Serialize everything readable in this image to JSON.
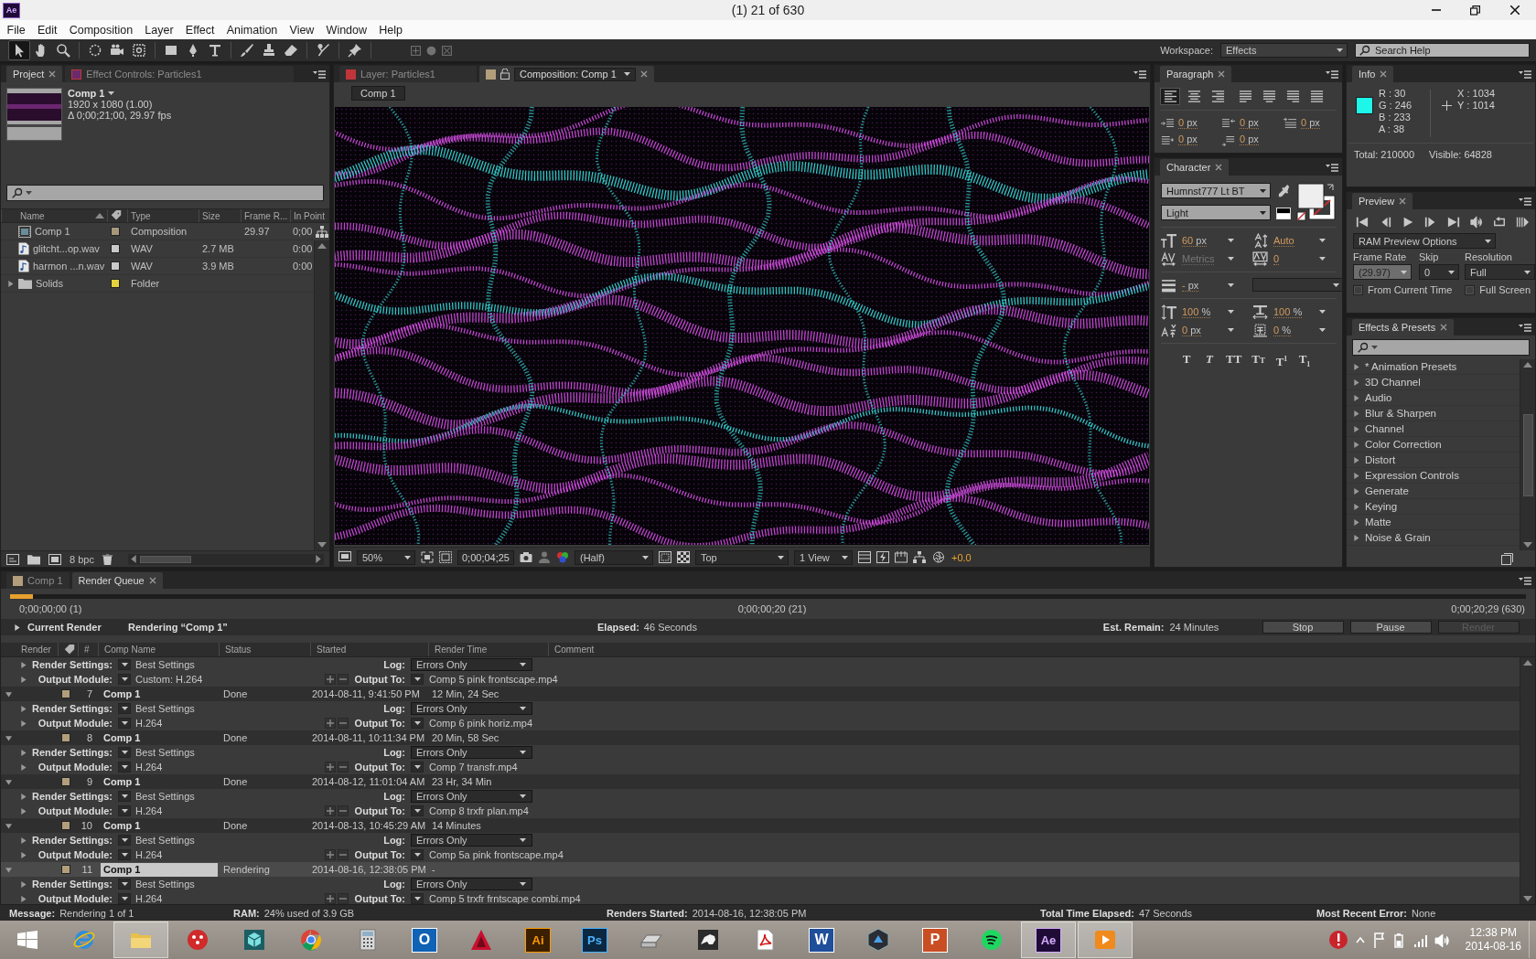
{
  "window": {
    "app_icon": "Ae",
    "title": "(1) 21 of 630"
  },
  "menu": [
    "File",
    "Edit",
    "Composition",
    "Layer",
    "Effect",
    "Animation",
    "View",
    "Window",
    "Help"
  ],
  "toolbar": {
    "tools": [
      {
        "kind": "selection",
        "selected": true
      },
      {
        "kind": "hand",
        "selected": false
      },
      {
        "kind": "zoom",
        "selected": false
      },
      {
        "kind": "rotate",
        "selected": false
      },
      {
        "kind": "camera",
        "selected": false
      },
      {
        "kind": "pan_behind",
        "selected": false
      },
      {
        "kind": "rectangle",
        "selected": false
      },
      {
        "kind": "pen",
        "selected": false
      },
      {
        "kind": "type",
        "selected": false
      },
      {
        "kind": "brush",
        "selected": false
      },
      {
        "kind": "stamp",
        "selected": false
      },
      {
        "kind": "eraser",
        "selected": false
      },
      {
        "kind": "roto",
        "selected": false
      },
      {
        "kind": "pin",
        "selected": false
      }
    ],
    "axis_modes": [
      {
        "kind": "local",
        "disabled": true
      },
      {
        "kind": "world",
        "disabled": true
      },
      {
        "kind": "view",
        "disabled": true
      }
    ],
    "workspace_label": "Workspace:",
    "workspace": "Effects",
    "search_placeholder": "Search Help"
  },
  "project": {
    "tabs": [
      {
        "label": "Project",
        "selected": true
      },
      {
        "kind": "effect_controls",
        "label": "Effect Controls: Particles1",
        "selected": false
      }
    ],
    "comp": {
      "name": "Comp 1",
      "size": "1920 x 1080 (1.00)",
      "duration": "Δ 0;00;21;00, 29.97 fps"
    },
    "columns": [
      "Name",
      "Type",
      "Size",
      "Frame R...",
      "In Point"
    ],
    "rows": [
      {
        "kind": "composition",
        "name": "Comp 1",
        "color": "#a8977b",
        "type": "Composition",
        "frame_rate": "29.97",
        "in_point": "0;00"
      },
      {
        "kind": "audio",
        "name": "glitcht...op.wav",
        "color": "#c9c9c9",
        "type": "WAV",
        "size": "2.7 MB",
        "in_point": "0:00"
      },
      {
        "kind": "audio",
        "name": "harmon ...n.wav",
        "color": "#c9c9c9",
        "type": "WAV",
        "size": "3.9 MB",
        "in_point": "0:00"
      },
      {
        "kind": "folder",
        "name": "Solids",
        "color": "#e3d23e",
        "type": "Folder",
        "expanded": false
      }
    ],
    "bit_depth": "8 bpc"
  },
  "composition": {
    "tabs": [
      {
        "kind": "layer",
        "label": "Layer: Particles1",
        "selected": false
      },
      {
        "kind": "composition",
        "label": "Composition: Comp 1",
        "selected": true,
        "locked": false
      }
    ],
    "breadcrumb": "Comp 1",
    "footer": {
      "zoom": "50%",
      "timecode": "0;00;04;25",
      "resolution": "(Half)",
      "view": "Top",
      "layout": "1 View",
      "exposure": "+0.0"
    }
  },
  "paragraph": {
    "tabs": [
      {
        "label": "Paragraph",
        "selected": true
      }
    ],
    "align": [
      {
        "kind": "left",
        "selected": true
      },
      {
        "kind": "center",
        "selected": false
      },
      {
        "kind": "right",
        "selected": false
      },
      {
        "kind": "justify_left",
        "selected": false
      },
      {
        "kind": "justify_center",
        "selected": false
      },
      {
        "kind": "justify_right",
        "selected": false
      },
      {
        "kind": "justify_all",
        "selected": false
      }
    ],
    "spacing": [
      {
        "kind": "indent_left",
        "value": "0",
        "unit": "px"
      },
      {
        "kind": "indent_right",
        "value": "0",
        "unit": "px"
      },
      {
        "kind": "indent_first",
        "value": "0",
        "unit": "px"
      },
      {
        "kind": "space_before",
        "value": "0",
        "unit": "px"
      },
      {
        "kind": "space_after",
        "value": "0",
        "unit": "px"
      }
    ]
  },
  "character": {
    "tabs": [
      {
        "label": "Character",
        "selected": true
      }
    ],
    "font": "Humnst777 Lt BT",
    "style": "Light",
    "groups": [
      [
        {
          "kind": "size",
          "value": "60",
          "unit": "px",
          "disabled": false
        },
        {
          "kind": "leading",
          "value": "Auto",
          "disabled": false
        },
        {
          "kind": "kerning",
          "value": "Metrics",
          "disabled": true
        },
        {
          "kind": "tracking",
          "value": "0",
          "disabled": false
        }
      ],
      [
        {
          "kind": "stroke",
          "value": "-",
          "unit": "px",
          "disabled": false
        }
      ],
      [
        {
          "kind": "vscale",
          "value": "100",
          "unit": "%",
          "disabled": false
        },
        {
          "kind": "hscale",
          "value": "100",
          "unit": "%",
          "disabled": false
        },
        {
          "kind": "baseline",
          "value": "0",
          "unit": "px",
          "disabled": false
        },
        {
          "kind": "tsume",
          "value": "0",
          "unit": "%",
          "disabled": false
        }
      ]
    ],
    "styles": [
      {
        "kind": "bold",
        "label": "T"
      },
      {
        "kind": "italic",
        "label": "T"
      },
      {
        "kind": "all_caps",
        "label": "TT"
      },
      {
        "kind": "small_caps",
        "label": "TT"
      },
      {
        "kind": "superscript",
        "label": "T$^{1}$"
      },
      {
        "kind": "subscript",
        "label": "T$_{1}$"
      }
    ]
  },
  "info": {
    "tabs": [
      {
        "label": "Info",
        "selected": true
      }
    ],
    "color": "#1ef6e9",
    "rgba": [
      "R : 30",
      "G : 246",
      "B : 233",
      "A : 38"
    ],
    "position": [
      "X : 1034",
      "Y : 1014"
    ],
    "total": "Total: 210000",
    "visible": "Visible: 64828"
  },
  "preview": {
    "tabs": [
      {
        "label": "Preview",
        "selected": true
      }
    ],
    "controls": [
      {
        "kind": "first"
      },
      {
        "kind": "previous"
      },
      {
        "kind": "play"
      },
      {
        "kind": "next"
      },
      {
        "kind": "last"
      },
      {
        "kind": "audio"
      },
      {
        "kind": "loop"
      },
      {
        "kind": "ram"
      }
    ],
    "options": "RAM Preview Options",
    "fields": [
      {
        "label": "Frame Rate",
        "value": "(29.97)"
      },
      {
        "label": "Skip",
        "value": "0"
      },
      {
        "label": "Resolution",
        "value": "Full"
      }
    ],
    "checkboxes": [
      {
        "label": "From Current Time",
        "checked": false
      },
      {
        "label": "Full Screen",
        "checked": false
      }
    ]
  },
  "effects": {
    "tabs": [
      {
        "label": "Effects & Presets",
        "selected": true
      }
    ],
    "items": [
      {
        "label": "* Animation Presets",
        "expanded": false
      },
      {
        "label": "3D Channel",
        "expanded": false
      },
      {
        "label": "Audio",
        "expanded": false
      },
      {
        "label": "Blur & Sharpen",
        "expanded": false
      },
      {
        "label": "Channel",
        "expanded": false
      },
      {
        "label": "Color Correction",
        "expanded": false
      },
      {
        "label": "Distort",
        "expanded": false
      },
      {
        "label": "Expression Controls",
        "expanded": false
      },
      {
        "label": "Generate",
        "expanded": false
      },
      {
        "label": "Keying",
        "expanded": false
      },
      {
        "label": "Matte",
        "expanded": false
      },
      {
        "label": "Noise & Grain",
        "expanded": false
      }
    ]
  },
  "render_queue": {
    "tabs": [
      {
        "kind": "composition",
        "label": "Comp 1",
        "selected": false
      },
      {
        "label": "Render Queue",
        "selected": true
      }
    ],
    "progress": {
      "level": 0.015,
      "start": "0;00;00;00 (1)",
      "current": "0;00;00;20 (21)",
      "end": "0;00;20;29 (630)"
    },
    "current": {
      "label": "Current Render",
      "status": "Rendering “Comp 1”",
      "expanded": false,
      "elapsed_label": "Elapsed:",
      "elapsed": "46 Seconds",
      "remain_label": "Est. Remain:",
      "remain": "24 Minutes"
    },
    "buttons": [
      {
        "label": "Stop",
        "disabled": false
      },
      {
        "label": "Pause",
        "disabled": false
      },
      {
        "label": "Render",
        "disabled": true
      }
    ],
    "columns": [
      "Render",
      "#",
      "Comp Name",
      "Status",
      "Started",
      "Render Time",
      "Comment"
    ],
    "items": [
      {
        "kind": "continued",
        "settings": {
          "label": "Render Settings:",
          "value": "Best Settings",
          "expanded": false,
          "log_label": "Log:",
          "log": "Errors Only"
        },
        "output": {
          "label": "Output Module:",
          "value": "Custom: H.264",
          "expanded": false,
          "to_label": "Output To:",
          "to": "Comp 5 pink frontscape.mp4"
        }
      },
      {
        "kind": "item",
        "number": "7",
        "comp": "Comp 1",
        "color": "#b39e7c",
        "status": "Done",
        "started": "2014-08-11, 9:41:50 PM",
        "render_time": "12 Min, 24 Sec",
        "expanded": true,
        "selected": false,
        "settings": {
          "label": "Render Settings:",
          "value": "Best Settings",
          "expanded": false,
          "log_label": "Log:",
          "log": "Errors Only"
        },
        "output": {
          "label": "Output Module:",
          "value": "H.264",
          "expanded": false,
          "to_label": "Output To:",
          "to": "Comp 6 pink horiz.mp4"
        }
      },
      {
        "kind": "item",
        "number": "8",
        "comp": "Comp 1",
        "color": "#b39e7c",
        "status": "Done",
        "started": "2014-08-11, 10:11:34 PM",
        "render_time": "20 Min, 58 Sec",
        "expanded": true,
        "selected": false,
        "settings": {
          "label": "Render Settings:",
          "value": "Best Settings",
          "expanded": false,
          "log_label": "Log:",
          "log": "Errors Only"
        },
        "output": {
          "label": "Output Module:",
          "value": "H.264",
          "expanded": false,
          "to_label": "Output To:",
          "to": "Comp 7 transfr.mp4"
        }
      },
      {
        "kind": "item",
        "number": "9",
        "comp": "Comp 1",
        "color": "#b39e7c",
        "status": "Done",
        "started": "2014-08-12, 11:01:04 AM",
        "render_time": "23 Hr, 34 Min",
        "expanded": true,
        "selected": false,
        "settings": {
          "label": "Render Settings:",
          "value": "Best Settings",
          "expanded": false,
          "log_label": "Log:",
          "log": "Errors Only"
        },
        "output": {
          "label": "Output Module:",
          "value": "H.264",
          "expanded": false,
          "to_label": "Output To:",
          "to": "Comp 8 trxfr plan.mp4"
        }
      },
      {
        "kind": "item",
        "number": "10",
        "comp": "Comp 1",
        "color": "#b39e7c",
        "status": "Done",
        "started": "2014-08-13, 10:45:29 AM",
        "render_time": "14 Minutes",
        "expanded": true,
        "selected": false,
        "settings": {
          "label": "Render Settings:",
          "value": "Best Settings",
          "expanded": false,
          "log_label": "Log:",
          "log": "Errors Only"
        },
        "output": {
          "label": "Output Module:",
          "value": "H.264",
          "expanded": false,
          "to_label": "Output To:",
          "to": "Comp 5a pink frontscape.mp4"
        }
      },
      {
        "kind": "item",
        "number": "11",
        "comp": "Comp 1",
        "color": "#b39e7c",
        "status": "Rendering",
        "started": "2014-08-16, 12:38:05 PM",
        "render_time": "-",
        "expanded": true,
        "selected": true,
        "settings": {
          "label": "Render Settings:",
          "value": "Best Settings",
          "expanded": false,
          "log_label": "Log:",
          "log": "Errors Only"
        },
        "output": {
          "label": "Output Module:",
          "value": "H.264",
          "expanded": false,
          "to_label": "Output To:",
          "to": "Comp 5 trxfr frntscape combi.mp4"
        }
      }
    ]
  },
  "status_bar": [
    {
      "label": "Message:",
      "value": "Rendering 1 of 1"
    },
    {
      "label": "RAM:",
      "value": "24% used of 3.9 GB"
    },
    {
      "label": "Renders Started:",
      "value": "2014-08-16, 12:38:05 PM"
    },
    {
      "label": "Total Time Elapsed:",
      "value": "47 Seconds"
    },
    {
      "label": "Most Recent Error:",
      "value": "None"
    }
  ],
  "taskbar": {
    "apps": [
      {
        "kind": "start",
        "selected": false
      },
      {
        "kind": "ie",
        "selected": false
      },
      {
        "kind": "explorer",
        "selected": true
      },
      {
        "kind": "red_app",
        "selected": false
      },
      {
        "kind": "maya",
        "selected": false
      },
      {
        "kind": "chrome",
        "selected": false
      },
      {
        "kind": "calculator",
        "selected": false
      },
      {
        "kind": "outlook",
        "label": "O",
        "selected": false
      },
      {
        "kind": "autocad",
        "selected": false
      },
      {
        "kind": "illustrator",
        "label": "Ai",
        "selected": false
      },
      {
        "kind": "photoshop",
        "label": "Ps",
        "selected": false
      },
      {
        "kind": "scanner",
        "selected": false
      },
      {
        "kind": "rhino",
        "selected": false
      },
      {
        "kind": "acrobat",
        "selected": false
      },
      {
        "kind": "word",
        "label": "W",
        "selected": false
      },
      {
        "kind": "hex_app",
        "selected": false
      },
      {
        "kind": "powerpoint",
        "label": "P",
        "selected": false
      },
      {
        "kind": "spotify",
        "selected": false
      },
      {
        "kind": "aftereffects",
        "label": "Ae",
        "selected": true
      },
      {
        "kind": "player",
        "selected": true
      }
    ],
    "tray": [
      {
        "kind": "alert"
      },
      {
        "kind": "show_hidden"
      },
      {
        "kind": "flag"
      },
      {
        "kind": "battery"
      },
      {
        "kind": "network"
      },
      {
        "kind": "volume"
      }
    ],
    "time": "12:38 PM",
    "date": "2014-08-16"
  }
}
